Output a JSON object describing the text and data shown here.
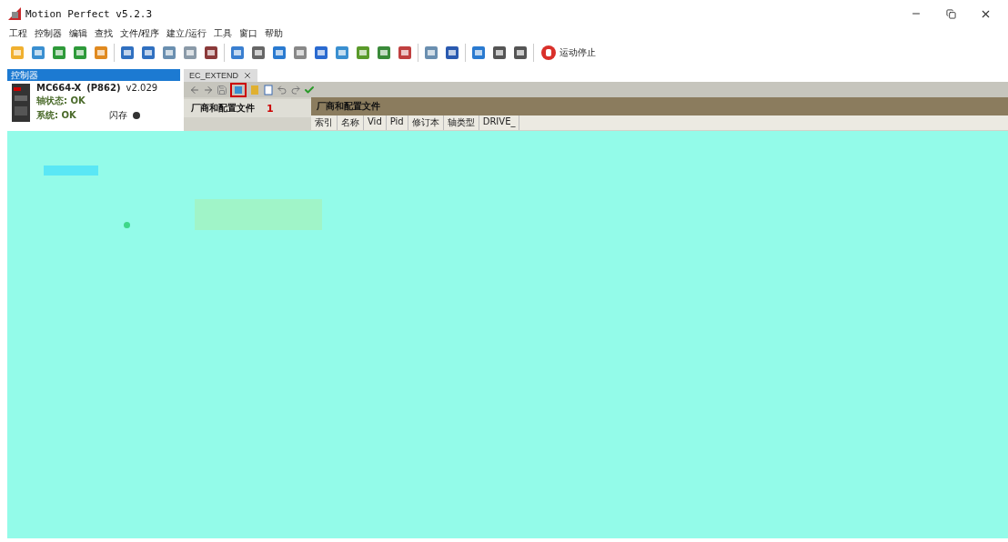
{
  "window": {
    "title": "Motion Perfect v5.2.3"
  },
  "menu": [
    "工程",
    "控制器",
    "编辑",
    "查找",
    "文件/程序",
    "建立/运行",
    "工具",
    "窗口",
    "帮助"
  ],
  "toolbar": {
    "stop_button": {
      "label": "运动停止"
    }
  },
  "controller_panel": {
    "title": "控制器",
    "model": "MC664-X",
    "code": "(P862)",
    "version": "v2.029",
    "axis_status": "轴状态: OK",
    "system_status": "系统: OK",
    "flash": "闪存"
  },
  "tabs": [
    {
      "label": "EC_EXTEND",
      "selected": true
    }
  ],
  "editor": {
    "nav": [
      {
        "label": "厂商和配置文件",
        "selected": true
      }
    ],
    "annotation": "1",
    "section_title": "厂商和配置文件",
    "columns": [
      "索引",
      "名称",
      "Vid",
      "Pid",
      "修订本",
      "轴类型",
      "DRIVE_"
    ]
  }
}
